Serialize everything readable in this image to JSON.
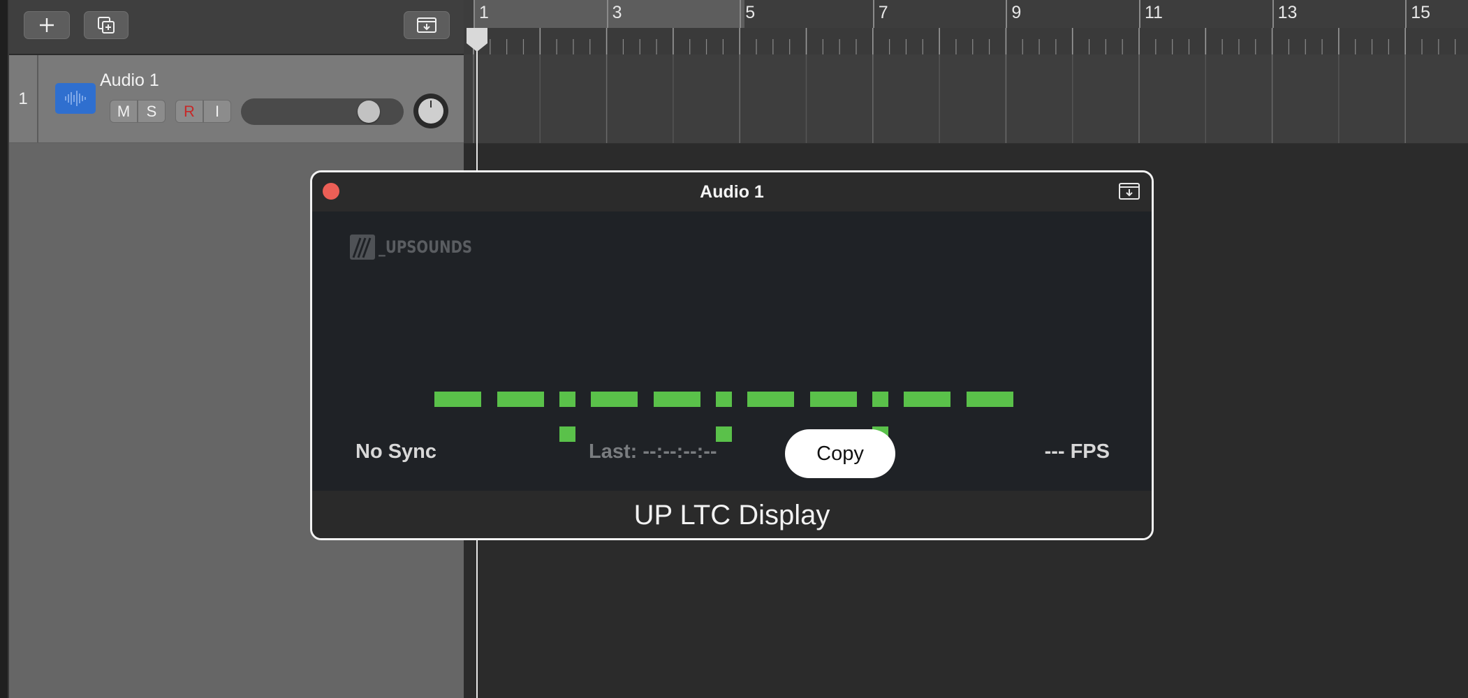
{
  "track_toolbar": {
    "add_track_icon": "plus-icon",
    "duplicate_track_icon": "duplicate-icon",
    "save_icon": "tray-download-icon"
  },
  "track": {
    "number": "1",
    "name": "Audio 1",
    "mute_label": "M",
    "solo_label": "S",
    "record_label": "R",
    "input_label": "I",
    "volume_level": 0.84,
    "icon": "waveform-icon"
  },
  "ruler": {
    "bar_labels": [
      "1",
      "3",
      "5",
      "7",
      "9",
      "11",
      "13",
      "15"
    ]
  },
  "plugin": {
    "window_title": "Audio 1",
    "brand": "_UPSOUNDS",
    "timecode": "--:--:--:--",
    "sync_status": "No Sync",
    "last_timecode": "Last: --:--:--:--",
    "copy_label": "Copy",
    "fps": "--- FPS",
    "footer_title": "UP LTC Display"
  },
  "colors": {
    "segment_green": "#5ac14a",
    "close_red": "#ec5f56",
    "track_icon_blue": "#2f6fcf"
  }
}
